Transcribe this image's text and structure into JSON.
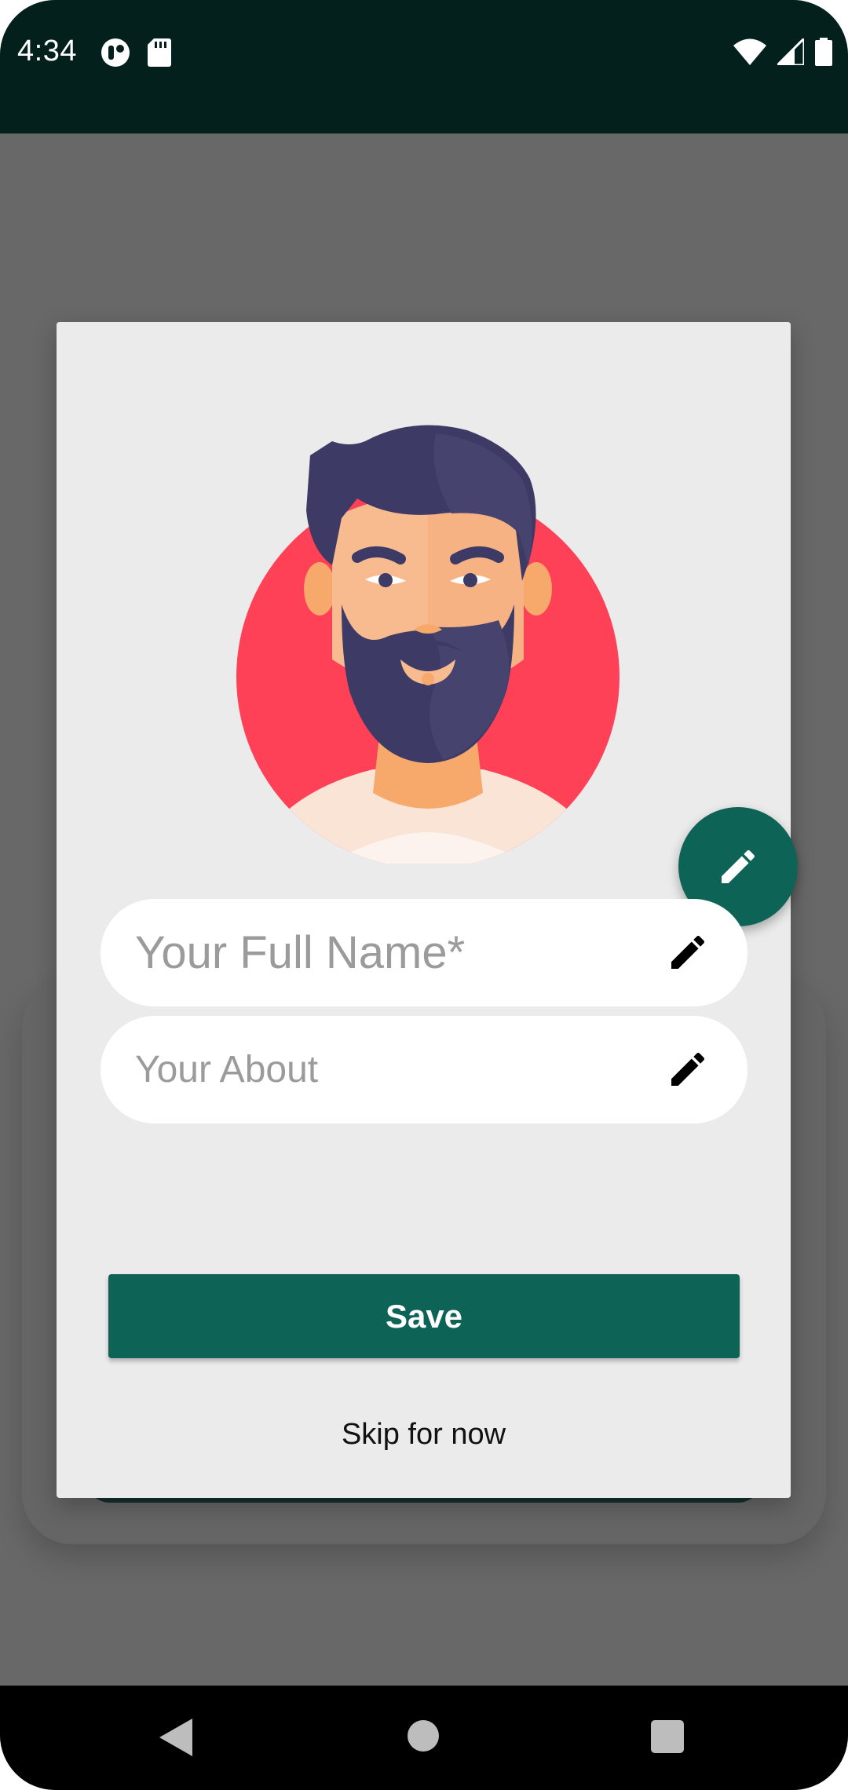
{
  "status_bar": {
    "time": "4:34",
    "icons": [
      "app-notification-icon",
      "sd-card-icon",
      "wifi-icon",
      "signal-icon",
      "battery-icon"
    ]
  },
  "dialog": {
    "avatar_alt": "profile-avatar",
    "name_field": {
      "placeholder": "Your Full Name*",
      "value": ""
    },
    "about_field": {
      "placeholder": "Your About",
      "value": ""
    },
    "save_label": "Save",
    "skip_label": "Skip for now"
  },
  "nav_bar": {
    "icons": [
      "back-icon",
      "home-icon",
      "recents-icon"
    ]
  },
  "colors": {
    "primary": "#0e6357",
    "status_bar": "#04201c",
    "scrim": "#686868",
    "dialog_bg": "#ebebeb",
    "avatar_circle": "#ff4157"
  }
}
